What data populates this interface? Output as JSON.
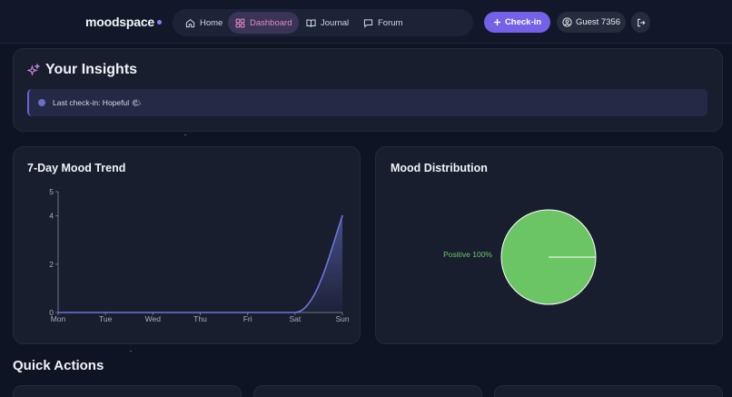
{
  "header": {
    "logo": "moodspace",
    "nav": [
      {
        "label": "Home",
        "icon": "home-icon",
        "active": false
      },
      {
        "label": "Dashboard",
        "icon": "dashboard-grid-icon",
        "active": true
      },
      {
        "label": "Journal",
        "icon": "book-icon",
        "active": false
      },
      {
        "label": "Forum",
        "icon": "chat-bubble-icon",
        "active": false
      }
    ],
    "checkin_label": "Check-in",
    "user_label": "Guest 7356"
  },
  "insights": {
    "title": "Your Insights",
    "last_checkin": "Last check-in: Hopeful 🌤"
  },
  "trend_card": {
    "title": "7-Day Mood Trend"
  },
  "distribution_card": {
    "title": "Mood Distribution"
  },
  "quick_actions": {
    "title": "Quick Actions"
  },
  "colors": {
    "accent": "#7561e8",
    "line": "#6c74d8",
    "pie": "#6cc564",
    "background": "#0f1424",
    "card": "#181e2e"
  },
  "chart_data": [
    {
      "type": "area",
      "x": [
        "Mon",
        "Tue",
        "Wed",
        "Thu",
        "Fri",
        "Sat",
        "Sun"
      ],
      "values": [
        0,
        0,
        0,
        0,
        0,
        0,
        4
      ],
      "yticks": [
        0,
        2,
        4,
        5
      ],
      "ylim": [
        0,
        5
      ],
      "grid": false
    },
    {
      "type": "pie",
      "slices": [
        {
          "label": "Positive",
          "value": 100,
          "display": "Positive 100%",
          "color": "#6cc564"
        }
      ]
    }
  ]
}
